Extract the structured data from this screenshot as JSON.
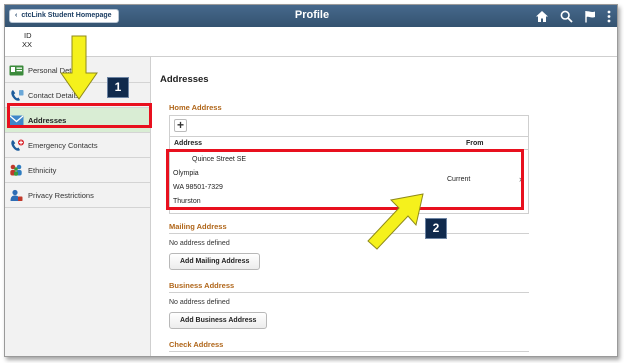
{
  "header": {
    "home_label": "ctcLink Student Homepage",
    "title": "Profile",
    "icons": [
      "home-icon",
      "search-icon",
      "flag-icon",
      "more-vertical-icon"
    ]
  },
  "id_bar": {
    "line1": "ID",
    "line2": "XX"
  },
  "sidebar": {
    "items": [
      {
        "label": "Personal Details",
        "icon": "personal-details-icon"
      },
      {
        "label": "Contact Details",
        "icon": "phone-icon"
      },
      {
        "label": "Addresses",
        "icon": "envelope-icon",
        "active": true
      },
      {
        "label": "Emergency Contacts",
        "icon": "emergency-phone-icon"
      },
      {
        "label": "Ethnicity",
        "icon": "people-icon"
      },
      {
        "label": "Privacy Restrictions",
        "icon": "privacy-user-icon"
      }
    ]
  },
  "main": {
    "heading": "Addresses",
    "home": {
      "title": "Home Address",
      "add_label": "+",
      "col_address": "Address",
      "col_from": "From",
      "address_lines": [
        "Quince Street SE",
        "Olympia",
        "WA 98501-7329",
        "Thurston"
      ],
      "from": "Current"
    },
    "mailing": {
      "title": "Mailing Address",
      "empty_text": "No address defined",
      "button": "Add Mailing Address"
    },
    "business": {
      "title": "Business Address",
      "empty_text": "No address defined",
      "button": "Add Business Address"
    },
    "check": {
      "title": "Check Address"
    }
  },
  "annotations": {
    "step1": "1",
    "step2": "2"
  },
  "colors": {
    "header": "#3c5a7a",
    "highlight": "#e8101e",
    "arrow": "#f5f11c",
    "section_title": "#b0661a",
    "active_nav": "#d9edd4"
  }
}
